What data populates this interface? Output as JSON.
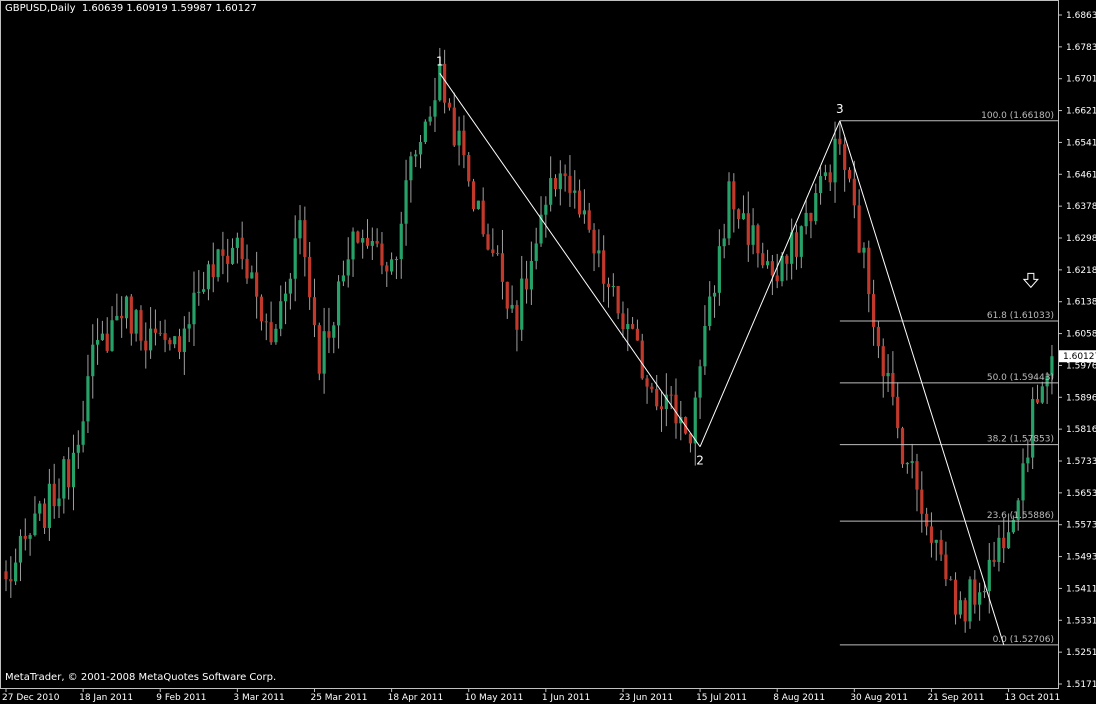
{
  "header": {
    "symbol": "GBPUSD,Daily",
    "quote": "1.60639 1.60919 1.59987 1.60127"
  },
  "copyright": "MetaTrader, © 2001-2008 MetaQuotes Software Corp.",
  "colors": {
    "background": "#000000",
    "axis": "#c0c0c0",
    "text": "#ffffff",
    "bull": "#26a269",
    "bear": "#c0392b",
    "wick": "#a0a0a0",
    "wave": "#ffffff",
    "fib": "#bdbdbd",
    "price_label_bg": "#ffffff"
  },
  "chart_data": {
    "type": "candlestick",
    "ylim": [
      1.517,
      1.689
    ],
    "price_ticks": [
      "1.68630",
      "1.67830",
      "1.67010",
      "1.66210",
      "1.65410",
      "1.64610",
      "1.63780",
      "1.62980",
      "1.62180",
      "1.61385",
      "1.60585",
      "1.59760",
      "1.58960",
      "1.58160",
      "1.57335",
      "1.56535",
      "1.55735",
      "1.54935",
      "1.54110",
      "1.53310",
      "1.52510",
      "1.51710"
    ],
    "date_ticks": [
      "27 Dec 2010",
      "18 Jan 2011",
      "9 Feb 2011",
      "3 Mar 2011",
      "25 Mar 2011",
      "18 Apr 2011",
      "10 May 2011",
      "1 Jun 2011",
      "23 Jun 2011",
      "15 Jul 2011",
      "8 Aug 2011",
      "30 Aug 2011",
      "21 Sep 2011",
      "13 Oct 2011"
    ],
    "current_price": "1.60127",
    "candle_count": 218,
    "date_tick_every": 16,
    "anchors": [
      {
        "index": 0,
        "price": 1.543
      },
      {
        "index": 5,
        "price": 1.555
      },
      {
        "index": 13,
        "price": 1.572
      },
      {
        "index": 18,
        "price": 1.6
      },
      {
        "index": 24,
        "price": 1.614
      },
      {
        "index": 34,
        "price": 1.601
      },
      {
        "index": 40,
        "price": 1.619
      },
      {
        "index": 48,
        "price": 1.631
      },
      {
        "index": 55,
        "price": 1.604
      },
      {
        "index": 61,
        "price": 1.636
      },
      {
        "index": 65,
        "price": 1.601
      },
      {
        "index": 73,
        "price": 1.633
      },
      {
        "index": 80,
        "price": 1.625
      },
      {
        "index": 84,
        "price": 1.65
      },
      {
        "index": 90,
        "price": 1.673
      },
      {
        "index": 98,
        "price": 1.638
      },
      {
        "index": 106,
        "price": 1.612
      },
      {
        "index": 115,
        "price": 1.651
      },
      {
        "index": 124,
        "price": 1.621
      },
      {
        "index": 133,
        "price": 1.596
      },
      {
        "index": 142,
        "price": 1.582
      },
      {
        "index": 150,
        "price": 1.643
      },
      {
        "index": 160,
        "price": 1.62
      },
      {
        "index": 173,
        "price": 1.656
      },
      {
        "index": 185,
        "price": 1.582
      },
      {
        "index": 198,
        "price": 1.535
      },
      {
        "index": 205,
        "price": 1.549
      },
      {
        "index": 210,
        "price": 1.568
      },
      {
        "index": 215,
        "price": 1.597
      },
      {
        "index": 217,
        "price": 1.6013
      }
    ],
    "waves": [
      {
        "label": "1",
        "index": 90,
        "price": 1.674
      },
      {
        "label": "2",
        "index": 144,
        "price": 1.578
      },
      {
        "label": "3",
        "index": 173,
        "price": 1.6618
      }
    ],
    "wave_end": {
      "index": 207,
      "price": 1.5271
    },
    "fib_levels": [
      {
        "level": "100.0",
        "price": 1.6618,
        "label": "100.0 (1.66180)"
      },
      {
        "level": "61.8",
        "price": 1.61033,
        "label": "61.8 (1.61033)"
      },
      {
        "level": "50.0",
        "price": 1.59443,
        "label": "50.0 (1.59443)"
      },
      {
        "level": "38.2",
        "price": 1.57853,
        "label": "38.2 (1.57853)"
      },
      {
        "level": "23.6",
        "price": 1.55886,
        "label": "23.6 (1.55886)"
      },
      {
        "level": "0.0",
        "price": 1.52706,
        "label": "0.0 (1.52706)"
      }
    ],
    "fib_start_index": 173,
    "arrow": {
      "index": 223,
      "price": 1.62,
      "icon": "down-arrow-icon"
    }
  }
}
